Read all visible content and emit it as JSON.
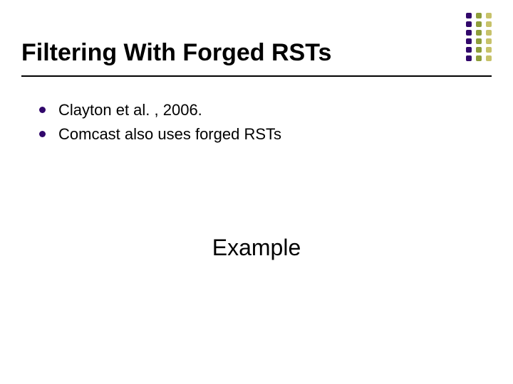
{
  "colors": {
    "bullet": "#31076b",
    "deco_cols": [
      "#31076b",
      "#8e9e3b",
      "#c7c26a"
    ]
  },
  "title": "Filtering With Forged RSTs",
  "bullets": [
    "Clayton et al. , 2006.",
    "Comcast also uses forged RSTs"
  ],
  "example_label": "Example",
  "deco_rows": 6,
  "deco_columns": 3
}
